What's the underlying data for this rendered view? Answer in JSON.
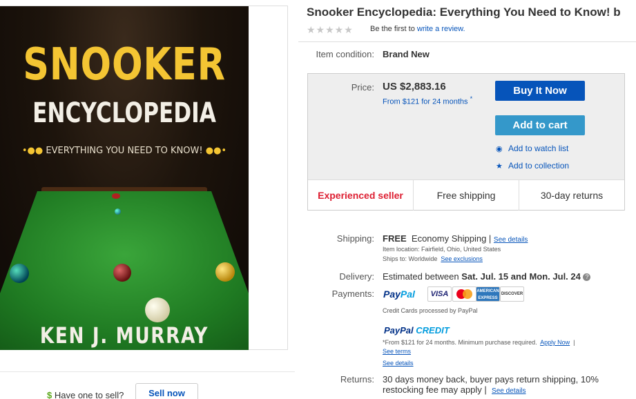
{
  "cover": {
    "line1": "SNOOKER",
    "line2": "ENCYCLOPEDIA",
    "tagline": "EVERYTHING YOU NEED TO KNOW!",
    "author": "KEN J. MURRAY"
  },
  "sell": {
    "question": "Have one to sell?",
    "button": "Sell now"
  },
  "product": {
    "title": "Snooker Encyclopedia: Everything You Need to Know! b",
    "review_prefix": "Be the first to",
    "review_link": "write a review."
  },
  "condition": {
    "label": "Item condition:",
    "value": "Brand New"
  },
  "buybox": {
    "price_label": "Price:",
    "price": "US $2,883.16",
    "finance": "From $121 for 24 months",
    "buy_now": "Buy It Now",
    "add_to_cart": "Add to cart",
    "watch": "Add to watch list",
    "collection": "Add to collection",
    "badges": [
      "Experienced seller",
      "Free shipping",
      "30-day returns"
    ]
  },
  "shipping": {
    "label": "Shipping:",
    "free": "FREE",
    "method": "Economy Shipping",
    "see_details": "See details",
    "location": "Item location:  Fairfield, Ohio, United States",
    "ships_to_prefix": "Ships to:  Worldwide",
    "see_exclusions": "See exclusions"
  },
  "delivery": {
    "label": "Delivery:",
    "prefix": "Estimated between",
    "dates": "Sat. Jul. 15 and Mon. Jul. 24"
  },
  "payments": {
    "label": "Payments:",
    "paypal_a": "Pay",
    "paypal_b": "Pal",
    "cards": [
      "VISA",
      "MasterCard",
      "AMERICAN EXPRESS",
      "DISCOVER"
    ],
    "processed": "Credit Cards processed by PayPal",
    "credit_a": "PayPal",
    "credit_b": "CREDIT",
    "credit_note": "*From $121 for 24 months. Minimum purchase required.",
    "apply_now": "Apply Now",
    "see_terms": "See terms",
    "see_details": "See details"
  },
  "returns": {
    "label": "Returns:",
    "text1": "30 days money back, buyer pays return shipping, 10%",
    "text2": "restocking fee may apply |",
    "see_details": "See details"
  },
  "colors": {
    "link": "#0654ba",
    "buy_button": "#0654ba",
    "cart_button": "#3498ca",
    "experienced": "#dd1e31"
  }
}
